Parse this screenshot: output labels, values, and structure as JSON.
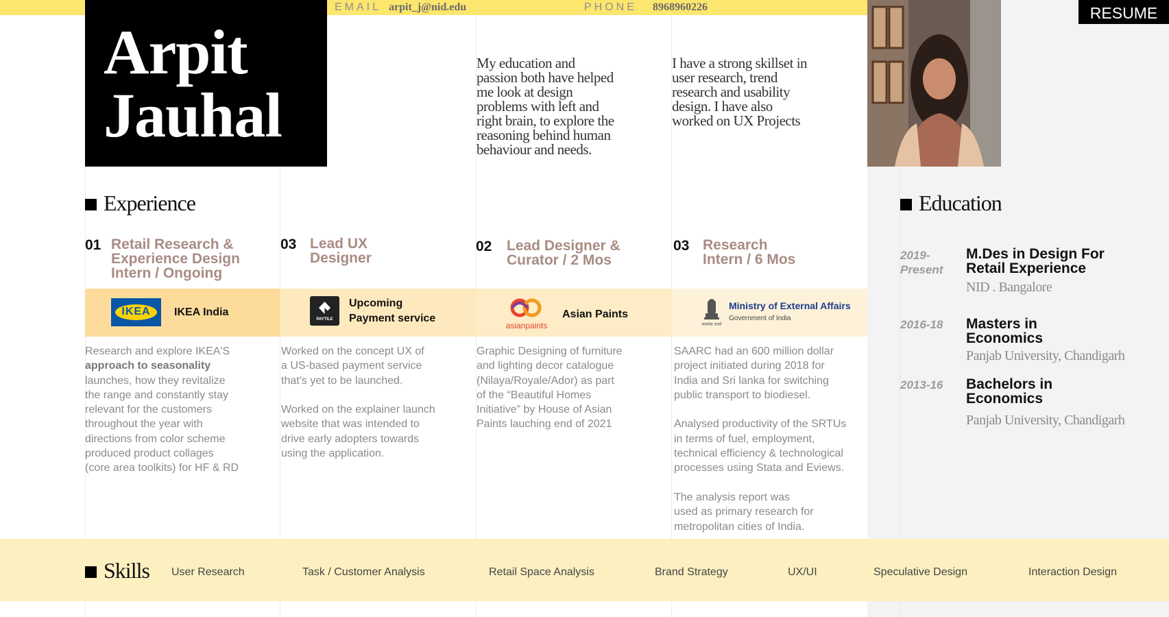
{
  "contact": {
    "email_label": "EMAIL",
    "email": "arpit_j@nid.edu",
    "phone_label": "PHONE",
    "phone": "8968960226"
  },
  "name": {
    "first": "Arpit",
    "last": "Jauhal"
  },
  "resume_button": "RESUME",
  "intro": {
    "left": [
      "My education and",
      "passion both have helped",
      "me look at design",
      "problems with left and",
      "right brain, to explore the",
      "reasoning behind human",
      "behaviour and needs."
    ],
    "right": [
      "I have a strong skillset in",
      "user research, trend",
      "research and usability",
      "design. I have also",
      "worked on UX Projects"
    ]
  },
  "experience": {
    "title": "Experience",
    "jobs": [
      {
        "num": "01",
        "title": [
          "Retail Research &",
          "Experience Design",
          "Intern / Ongoing"
        ],
        "company": "IKEA India",
        "logo_text": "IKEA",
        "desc": [
          "Research and explore IKEA'S",
          "approach to seasonality",
          "launches, how they revitalize",
          "the range and constantly stay",
          "relevant for the customers",
          "throughout the year with",
          "directions from color scheme",
          "produced product collages",
          "(core area toolkits) for HF & RD"
        ]
      },
      {
        "num": "03",
        "title": [
          "Lead UX",
          "Designer"
        ],
        "company": [
          "Upcoming",
          "Payment service"
        ],
        "logo_text": "PAYTILE",
        "desc": [
          "Worked on the concept UX of",
          "a US-based payment service",
          "that's yet to be launched.",
          "",
          "Worked on the explainer launch",
          "website that was intended to",
          "drive early adopters towards",
          "using the application."
        ]
      },
      {
        "num": "02",
        "title": [
          "Lead Designer &",
          "Curator / 2 Mos"
        ],
        "company": "Asian Paints",
        "logo_text": "asianpaints",
        "desc": [
          "Graphic Designing of furniture",
          "and lighting decor catalogue",
          "(Nilaya/Royale/Ador) as part",
          "of the “Beautiful Homes",
          "Initiative” by House of Asian",
          "Paints lauching end of 2021"
        ]
      },
      {
        "num": "03",
        "title": [
          "Research",
          "Intern / 6 Mos"
        ],
        "company": [
          "Ministry of External Affairs",
          "Government of India"
        ],
        "logo_text": "सत्यमेव जयते",
        "desc": [
          "SAARC had an 600 million dollar",
          "project initiated during 2018 for",
          "India and Sri lanka for switching",
          "public transport to biodiesel.",
          "",
          "Analysed productivity of the SRTUs",
          "in terms of fuel, employment,",
          "technical efficiency & technological",
          "processes using Stata and Eviews.",
          "",
          "The analysis report was",
          "used as primary research for",
          "metropolitan cities of India."
        ]
      }
    ]
  },
  "education": {
    "title": "Education",
    "items": [
      {
        "year": [
          "2019-",
          "Present"
        ],
        "degree": [
          "M.Des in Design For",
          "Retail Experience"
        ],
        "school": "NID . Bangalore"
      },
      {
        "year": [
          "2016-18"
        ],
        "degree": [
          "Masters in",
          "Economics"
        ],
        "school": "Panjab University, Chandigarh"
      },
      {
        "year": [
          "2013-16"
        ],
        "degree": [
          "Bachelors in",
          "Economics"
        ],
        "school": "Panjab University, Chandigarh"
      }
    ]
  },
  "skills": {
    "title": "Skills",
    "items": [
      "User Research",
      "Task / Customer Analysis",
      "Retail Space Analysis",
      "Brand Strategy",
      "UX/UI",
      "Speculative Design",
      "Interaction Design"
    ]
  },
  "colors": {
    "accent_yellow": "#fde66e",
    "skills_band": "#fdf0c0",
    "job_title": "#a88c83"
  }
}
